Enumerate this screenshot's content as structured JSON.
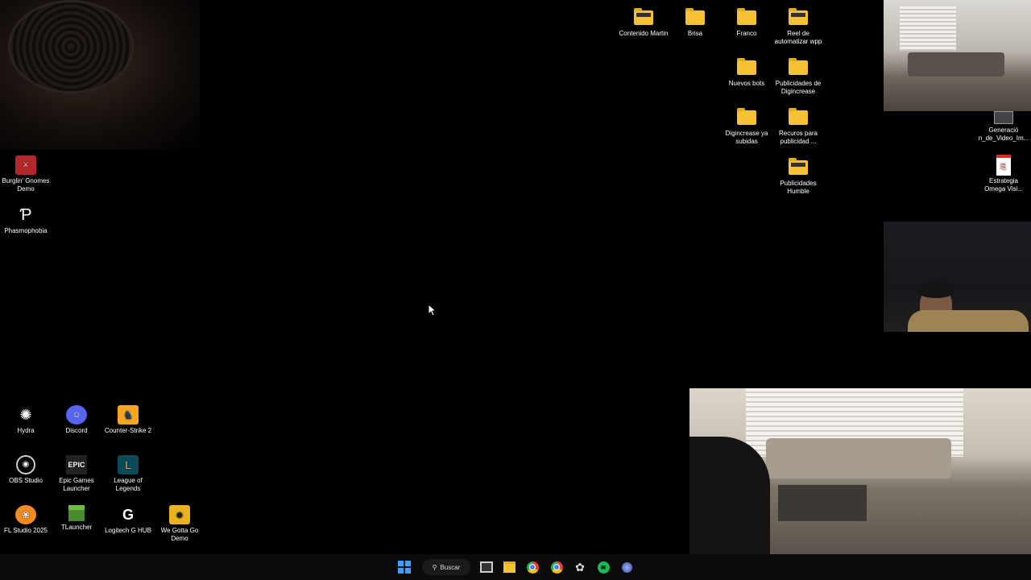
{
  "desktop": {
    "left_icons": [
      {
        "label": "Burglin' Gnomes Demo",
        "icon": "gnome-game-icon"
      },
      {
        "label": "Phasmophobia",
        "icon": "phasmophobia-icon"
      },
      {
        "label": "Hydra",
        "icon": "hydra-icon"
      },
      {
        "label": "Discord",
        "icon": "discord-icon"
      },
      {
        "label": "Counter-Strike 2",
        "icon": "cs2-icon"
      },
      {
        "label": "OBS Studio",
        "icon": "obs-icon"
      },
      {
        "label": "Epic Games Launcher",
        "icon": "epic-games-icon"
      },
      {
        "label": "League of Legends",
        "icon": "league-icon"
      },
      {
        "label": "FL Studio 2025",
        "icon": "fl-studio-icon"
      },
      {
        "label": "TLauncher",
        "icon": "tlauncher-icon"
      },
      {
        "label": "Logitech G HUB",
        "icon": "logitech-icon"
      },
      {
        "label": "We Gotta Go Demo",
        "icon": "we-gotta-go-icon"
      }
    ],
    "right_icons": [
      {
        "label": "Contenido Martin",
        "icon": "folder-icon"
      },
      {
        "label": "Brisa",
        "icon": "folder-icon"
      },
      {
        "label": "Franco",
        "icon": "folder-icon"
      },
      {
        "label": "Reel de automatizar wpp",
        "icon": "folder-icon"
      },
      {
        "label": "Nuevos bots",
        "icon": "folder-icon"
      },
      {
        "label": "Publicidades de Digincrease",
        "icon": "folder-icon"
      },
      {
        "label": "Digincrease ya subidas",
        "icon": "folder-icon"
      },
      {
        "label": "Recuros para publicidad ...",
        "icon": "folder-icon"
      },
      {
        "label": "Publicidades Humble",
        "icon": "folder-icon"
      },
      {
        "label": "Generació n_de_Video_Im...",
        "icon": "video-file-icon"
      },
      {
        "label": "Estrategia Omega Visi...",
        "icon": "pdf-icon"
      }
    ]
  },
  "taskbar": {
    "search_label": "Buscar",
    "apps": [
      "windows-start-icon",
      "task-view-icon",
      "file-explorer-icon",
      "chrome-icon",
      "chrome-profile-icon",
      "chatgpt-icon",
      "spotify-icon",
      "app-icon"
    ]
  },
  "colors": {
    "folder": "#f5c233",
    "spotify": "#1db954",
    "windows": "#3aa0ff"
  }
}
